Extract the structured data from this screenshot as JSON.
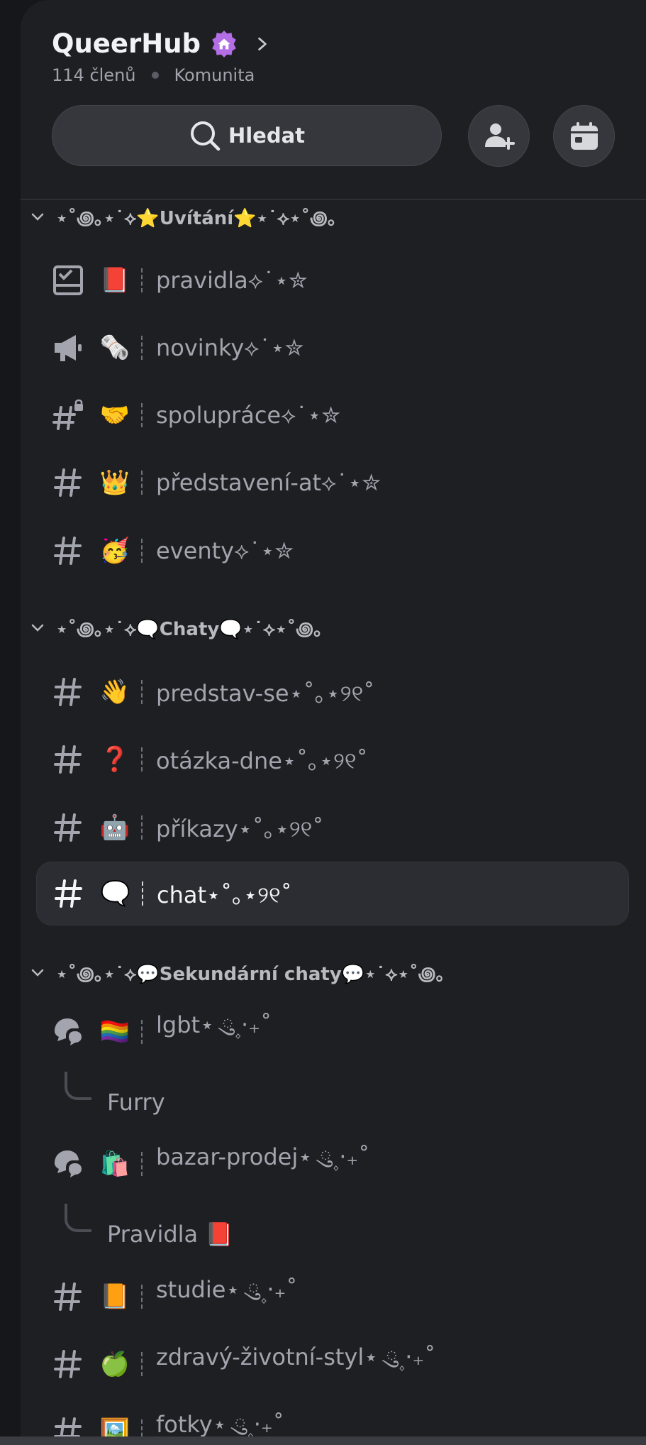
{
  "server": {
    "name": "QueerHub",
    "members": "114 členů",
    "type": "Komunita",
    "search_label": "Hledat",
    "accent": "#b36ee6"
  },
  "categories": [
    {
      "name": "⋆˚꩜｡⋆˙⟡⭐Uvítání⭐⋆˙⟡⋆˚꩜｡",
      "channels": [
        {
          "icon": "rules-icon",
          "emoji": "📕",
          "name": "pravidla⟡˙⋆✮"
        },
        {
          "icon": "megaphone-icon",
          "emoji": "🗞️",
          "name": "novinky⟡˙⋆✮"
        },
        {
          "icon": "locked-hashtag-icon",
          "emoji": "🤝",
          "name": "spolupráce⟡˙⋆✮"
        },
        {
          "icon": "hashtag-icon",
          "emoji": "👑",
          "name": "představení-at⟡˙⋆✮"
        },
        {
          "icon": "hashtag-icon",
          "emoji": "🥳",
          "name": "eventy⟡˙⋆✮"
        }
      ]
    },
    {
      "name": "⋆˚꩜｡⋆˙⟡🗨️Chaty🗨️⋆˙⟡⋆˚꩜｡",
      "channels": [
        {
          "icon": "hashtag-icon",
          "emoji": "👋",
          "name": "predstav-se⋆˚｡⋆୨୧˚"
        },
        {
          "icon": "hashtag-icon",
          "emoji": "❓",
          "name": "otázka-dne⋆˚｡⋆୨୧˚"
        },
        {
          "icon": "hashtag-icon",
          "emoji": "🤖",
          "name": "příkazy⋆˚｡⋆୨୧˚"
        },
        {
          "icon": "hashtag-icon",
          "emoji": "🗨️",
          "name": "chat⋆˚｡⋆୨୧˚",
          "active": true
        }
      ]
    },
    {
      "name": "⋆˚꩜｡⋆˙⟡💬Sekundární chaty💬⋆˙⟡⋆˚꩜｡",
      "channels": [
        {
          "icon": "forum-icon",
          "emoji": "🏳️‍🌈",
          "name": "lgbt⋆ ུ۪ ‧₊˚",
          "thread": "Furry"
        },
        {
          "icon": "forum-icon",
          "emoji": "🛍️",
          "name": "bazar-prodej⋆ ུ۪ ‧₊˚",
          "thread": "Pravidla 📕"
        },
        {
          "icon": "hashtag-icon",
          "emoji": "📙",
          "name": "studie⋆ ུ۪ ‧₊˚"
        },
        {
          "icon": "hashtag-icon",
          "emoji": "🍏",
          "name": "zdravý-životní-styl⋆ ུ۪ ‧₊˚"
        },
        {
          "icon": "hashtag-icon",
          "emoji": "🖼️",
          "name": "fotky⋆ ུ۪ ‧₊˚"
        }
      ]
    }
  ]
}
